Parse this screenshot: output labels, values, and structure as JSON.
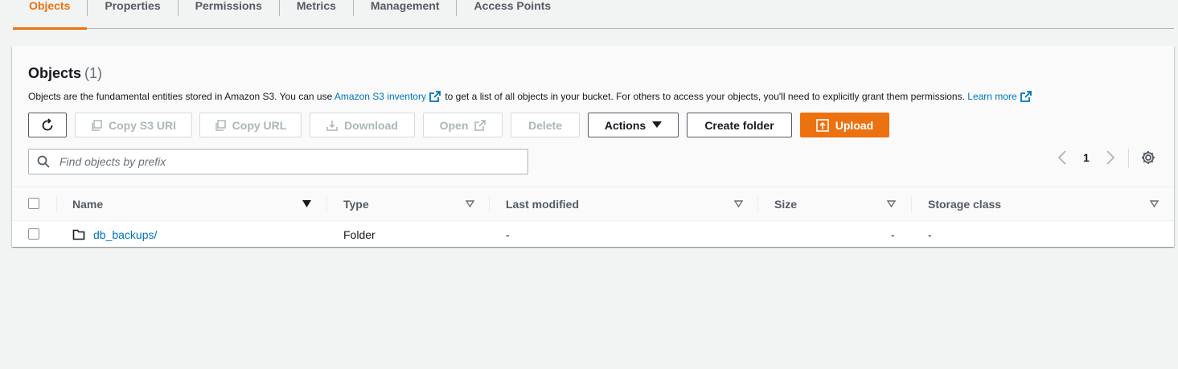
{
  "tabs": [
    {
      "label": "Objects",
      "active": true
    },
    {
      "label": "Properties"
    },
    {
      "label": "Permissions"
    },
    {
      "label": "Metrics"
    },
    {
      "label": "Management"
    },
    {
      "label": "Access Points"
    }
  ],
  "header": {
    "title": "Objects",
    "count": "(1)",
    "desc_part1": "Objects are the fundamental entities stored in Amazon S3. You can use",
    "desc_link1": "Amazon S3 inventory",
    "desc_part2": "to get a list of all objects in your bucket. For others to access your objects, you'll need to explicitly grant them permissions.",
    "desc_link2": "Learn more"
  },
  "toolbar": {
    "refresh_icon": "refresh-icon",
    "copy_s3_uri": "Copy S3 URI",
    "copy_url": "Copy URL",
    "download": "Download",
    "open": "Open",
    "delete": "Delete",
    "actions": "Actions",
    "create_folder": "Create folder",
    "upload": "Upload"
  },
  "search": {
    "placeholder": "Find objects by prefix",
    "value": ""
  },
  "pagination": {
    "current_page": "1"
  },
  "table": {
    "columns": [
      "Name",
      "Type",
      "Last modified",
      "Size",
      "Storage class"
    ],
    "rows": [
      {
        "name": "db_backups/",
        "type": "Folder",
        "last_modified": "-",
        "size": "-",
        "storage_class": "-"
      }
    ]
  },
  "colors": {
    "accent": "#ec7211",
    "link": "#0073bb",
    "text": "#16191f",
    "muted": "#545b64"
  }
}
